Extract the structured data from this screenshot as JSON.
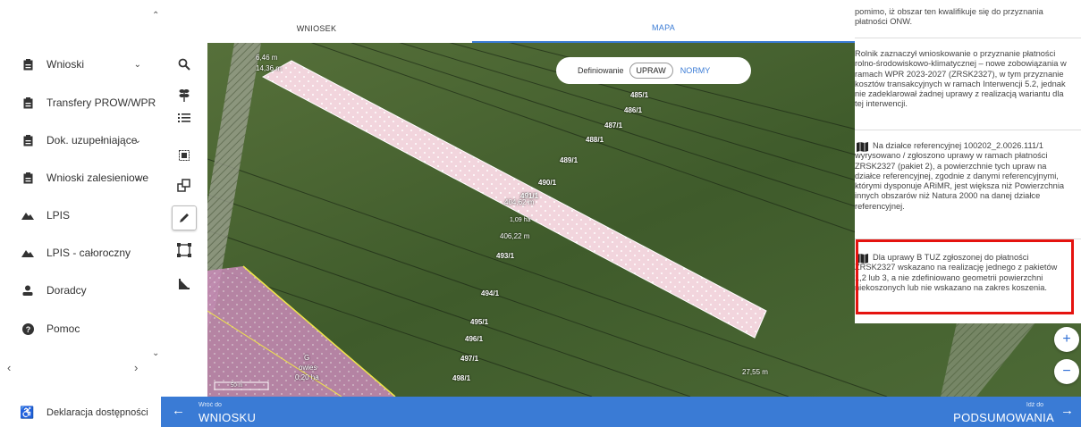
{
  "sidebar": {
    "items": [
      {
        "label": "Wnioski",
        "chevron": "⌄",
        "icon": "document-icon"
      },
      {
        "label": "Transfery PROW/WPR",
        "chevron": "",
        "icon": "document-icon"
      },
      {
        "label": "Dok. uzupełniające",
        "chevron": "⌄",
        "icon": "document-icon"
      },
      {
        "label": "Wnioski zalesieniowe",
        "chevron": "⌄",
        "icon": "document-icon"
      },
      {
        "label": "LPIS",
        "chevron": "",
        "icon": "terrain-icon"
      },
      {
        "label": "LPIS - całoroczny",
        "chevron": "",
        "icon": "terrain-icon"
      },
      {
        "label": "Doradcy",
        "chevron": "",
        "icon": "person-icon"
      },
      {
        "label": "Pomoc",
        "chevron": "",
        "icon": "help-icon"
      }
    ],
    "footer_label": "Deklaracja dostępności"
  },
  "tabs": {
    "wniosek": "WNIOSEK",
    "mapa": "MAPA"
  },
  "toggle": {
    "prefix": "Definiowanie",
    "option_a": "UPRAW",
    "option_b": "NORMY"
  },
  "map": {
    "parcel_labels": [
      "485/1",
      "486/1",
      "487/1",
      "488/1",
      "489/1",
      "490/1",
      "491/1",
      "493/1",
      "494/1",
      "495/1",
      "496/1",
      "497/1",
      "498/1"
    ],
    "measure_labels": {
      "top_a": "6,46 m",
      "top_b": "14,36 m",
      "mid_a": "404,62 m",
      "area": "1,09 ha",
      "mid_b": "406,22 m",
      "right": "27,55 m"
    },
    "bottom_left_plot": {
      "code": "G",
      "crop": "owies",
      "area": "0,20 ha"
    },
    "scale": "50 m"
  },
  "panel": {
    "messages": [
      "pomimo, iż obszar ten kwalifikuje się do przyznania płatności ONW.",
      "Rolnik zaznaczył wnioskowanie o przyznanie płatności rolno-środowiskowo-klimatycznej – nowe zobowiązania w ramach WPR 2023-2027 (ZRSK2327), w tym przyznanie kosztów transakcyjnych w ramach Interwencji 5.2, jednak nie zadeklarował żadnej uprawy z realizacją wariantu dla tej interwencji.",
      "Na działce referencyjnej 100202_2.0026.111/1 wyrysowano / zgłoszono uprawy w ramach płatności ZRSK2327 (pakiet 2), a powierzchnie tych upraw na działce referencyjnej, zgodnie z danymi referencyjnymi, którymi dysponuje ARiMR, jest większa niż Powierzchnia innych obszarów niż Natura 2000 na danej działce referencyjnej.",
      "Dla uprawy B TUZ zgłoszonej do płatności ZRSK2327 wskazano na realizację jednego z pakietów 1,2 lub 3, a nie zdefiniowano geometrii powierzchni niekoszonych lub nie wskazano na zakres koszenia."
    ]
  },
  "bottom": {
    "back_small": "Wróć do",
    "back_big": "WNIOSKU",
    "next_small": "Idź do",
    "next_big": "PODSUMOWANIA"
  },
  "colors": {
    "accent": "#3a7bd5",
    "highlight": "#e5130f",
    "parcel_fill": "#f3d6de"
  }
}
